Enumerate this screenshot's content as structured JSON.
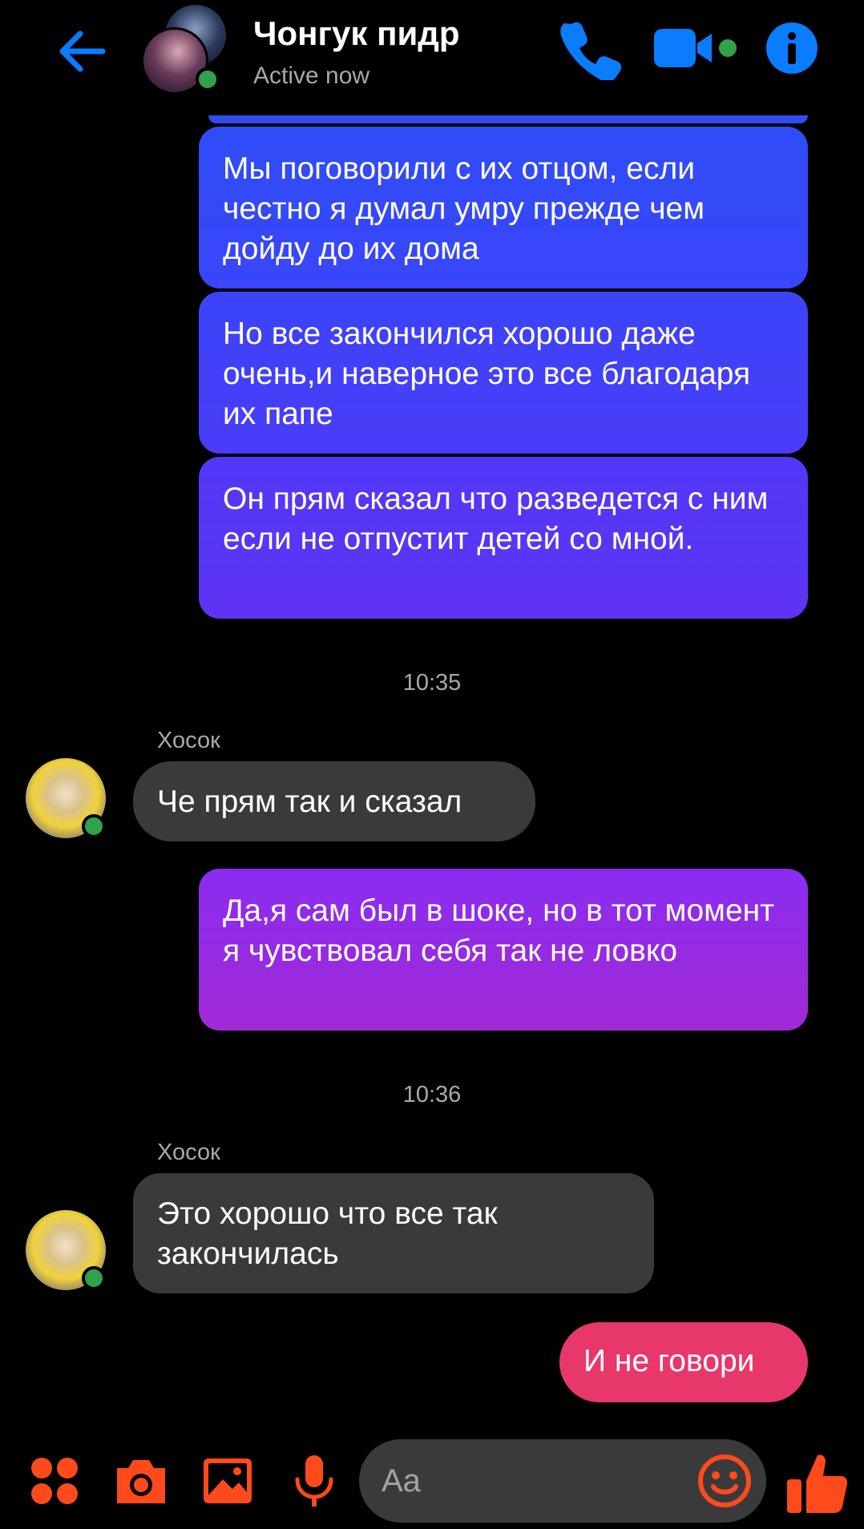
{
  "header": {
    "title": "Чонгук пидр",
    "status": "Active now"
  },
  "messages": [
    {
      "from": "me",
      "text": "Мы поговорили с их отцом, если честно я думал умру прежде чем дойду до их дома"
    },
    {
      "from": "me",
      "text": "Но все закончился хорошо даже очень,и наверное это все благодаря их папе"
    },
    {
      "from": "me",
      "text": "Он прям сказал что разведется с ним если не отпустит детей со мной."
    },
    {
      "type": "time",
      "text": "10:35"
    },
    {
      "from": "them",
      "sender": "Хосок",
      "text": "Че прям так и сказал"
    },
    {
      "from": "me",
      "text": "Да,я сам был в шоке, но в тот момент я чувствовал себя так не ловко"
    },
    {
      "type": "time",
      "text": "10:36"
    },
    {
      "from": "them",
      "sender": "Хосок",
      "text": "Это хорошо что все так закончилась"
    },
    {
      "from": "me",
      "text": "И не говори"
    }
  ],
  "composer": {
    "placeholder": "Aa"
  },
  "colors": {
    "accent_blue": "#0a7cff",
    "composer_accent": "#ff4a1c",
    "online": "#31a24c"
  },
  "icons": [
    "back-arrow-icon",
    "phone-icon",
    "video-icon",
    "info-icon",
    "menu-dots-icon",
    "camera-icon",
    "image-icon",
    "microphone-icon",
    "emoji-icon",
    "thumbs-up-icon"
  ]
}
